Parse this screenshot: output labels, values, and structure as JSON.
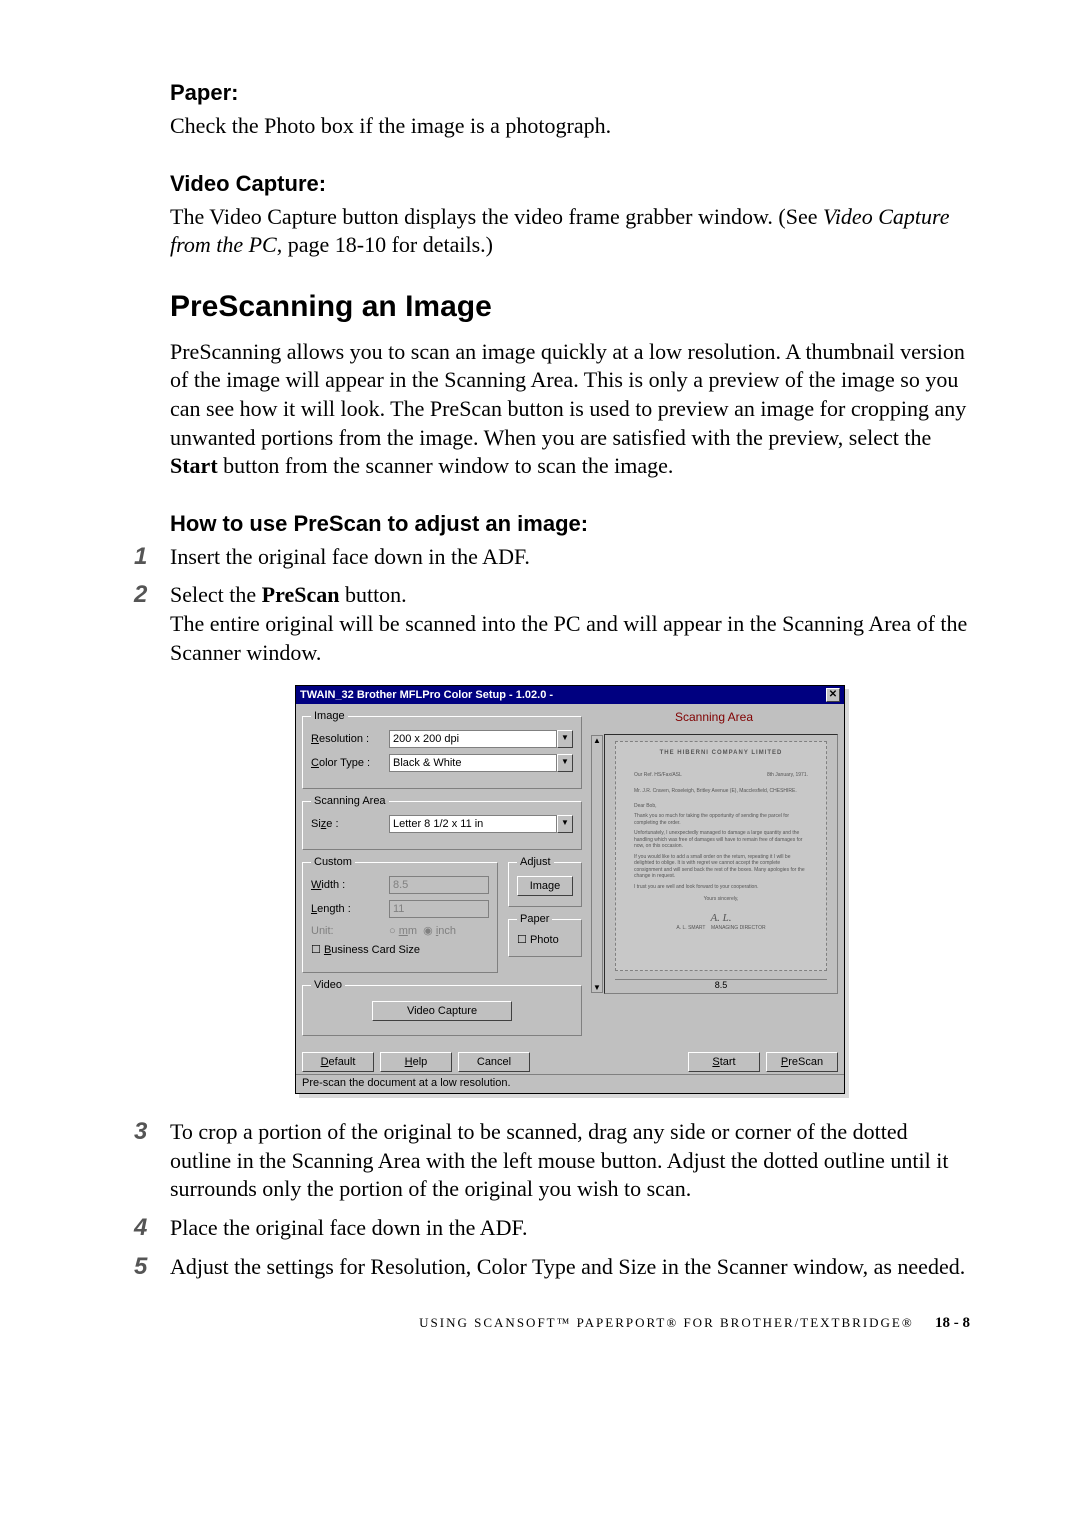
{
  "paper": {
    "heading": "Paper:",
    "body": "Check the Photo box if the image is a photograph."
  },
  "video_capture": {
    "heading": "Video Capture:",
    "body_pre": "The Video Capture button displays the video frame grabber window. (See ",
    "body_ital": "Video Capture from the PC",
    "body_post": ", page 18-10 for details.)"
  },
  "prescan": {
    "heading": "PreScanning an Image",
    "body": "PreScanning allows you to scan an image quickly at a low resolution.  A thumbnail version of the image will appear in the Scanning Area.  This is only a preview of the image so you can see how it will look. The PreScan button is used to preview an image for cropping any unwanted portions from the image. When you are satisfied with the preview, select the Start button from the scanner window to scan the image.",
    "start_word": "Start",
    "howto_heading": "How to use PreScan to adjust an image:"
  },
  "steps": [
    {
      "num": "1",
      "text": "Insert the original face down in the ADF."
    },
    {
      "num": "2",
      "prefix": "Select the ",
      "bold": "PreScan",
      "suffix": " button.",
      "extra": "The entire original will be scanned into the PC and will appear in the Scanning Area of the Scanner window."
    },
    {
      "num": "3",
      "text": "To crop a portion of the original to be scanned, drag any side or corner of the dotted outline in the Scanning Area with the left mouse button. Adjust the dotted outline until it surrounds only the portion of the original you wish to scan."
    },
    {
      "num": "4",
      "text": "Place the original face down in the ADF."
    },
    {
      "num": "5",
      "text": "Adjust the settings for Resolution, Color Type and Size in the Scanner window, as needed."
    }
  ],
  "dialog": {
    "title": "TWAIN_32 Brother MFLPro Color Setup - 1.02.0 -",
    "groups": {
      "image": "Image",
      "resolution_lbl": "Resolution :",
      "resolution_val": "200 x 200 dpi",
      "color_lbl": "Color Type :",
      "color_val": "Black & White",
      "scanarea": "Scanning Area",
      "size_lbl": "Size :",
      "size_val": "Letter 8 1/2 x 11 in",
      "custom": "Custom",
      "width_lbl": "Width :",
      "width_val": "8.5",
      "length_lbl": "Length :",
      "length_val": "11",
      "unit_lbl": "Unit:",
      "unit_mm": "mm",
      "unit_inch": "inch",
      "bcard": "Business Card Size",
      "adjust": "Adjust",
      "image_btn": "Image",
      "paper": "Paper",
      "photo": "Photo",
      "video": "Video",
      "video_btn": "Video Capture"
    },
    "buttons": {
      "default": "Default",
      "help": "Help",
      "cancel": "Cancel",
      "start": "Start",
      "prescan": "PreScan"
    },
    "status": "Pre-scan the document at a low resolution.",
    "right_label": "Scanning Area",
    "ruler": "8.5",
    "preview": {
      "letterhead": "THE HIBERNI COMPANY LIMITED",
      "our_ref": "Our Ref.  HS/Fax/ASL",
      "date": "8th January, 1971.",
      "addr": "Mr. J.R. Craven,\nRoseleigh,\nBritley Avenue  (E),\nMacclesfield,\nCHESHIRE.",
      "salute": "Dear Bob,",
      "p1": "Thank you so much for taking the opportunity of sending the parcel for completing the order.",
      "p2": "Unfortunately, I unexpectedly managed to damage a large quantity and the handling which was free of damages will have to remain free of damages for now, on this occasion.",
      "p3": "If you would like to add a small order on the return, repeating it I will be delighted to oblige. It is with regret we cannot accept the complete consignment and will send back the rest of the boxes. Many apologies for the change in request.",
      "p4": "I trust you are well and look forward to your cooperation.",
      "close": "Yours sincerely,",
      "sig": "A. L.",
      "sigline1": "A. L. SMART",
      "sigline2": "MANAGING DIRECTOR"
    }
  },
  "footer": {
    "text": "USING SCANSOFT™ PAPERPORT® FOR BROTHER/TEXTBRIDGE®",
    "page": "18 - 8"
  }
}
